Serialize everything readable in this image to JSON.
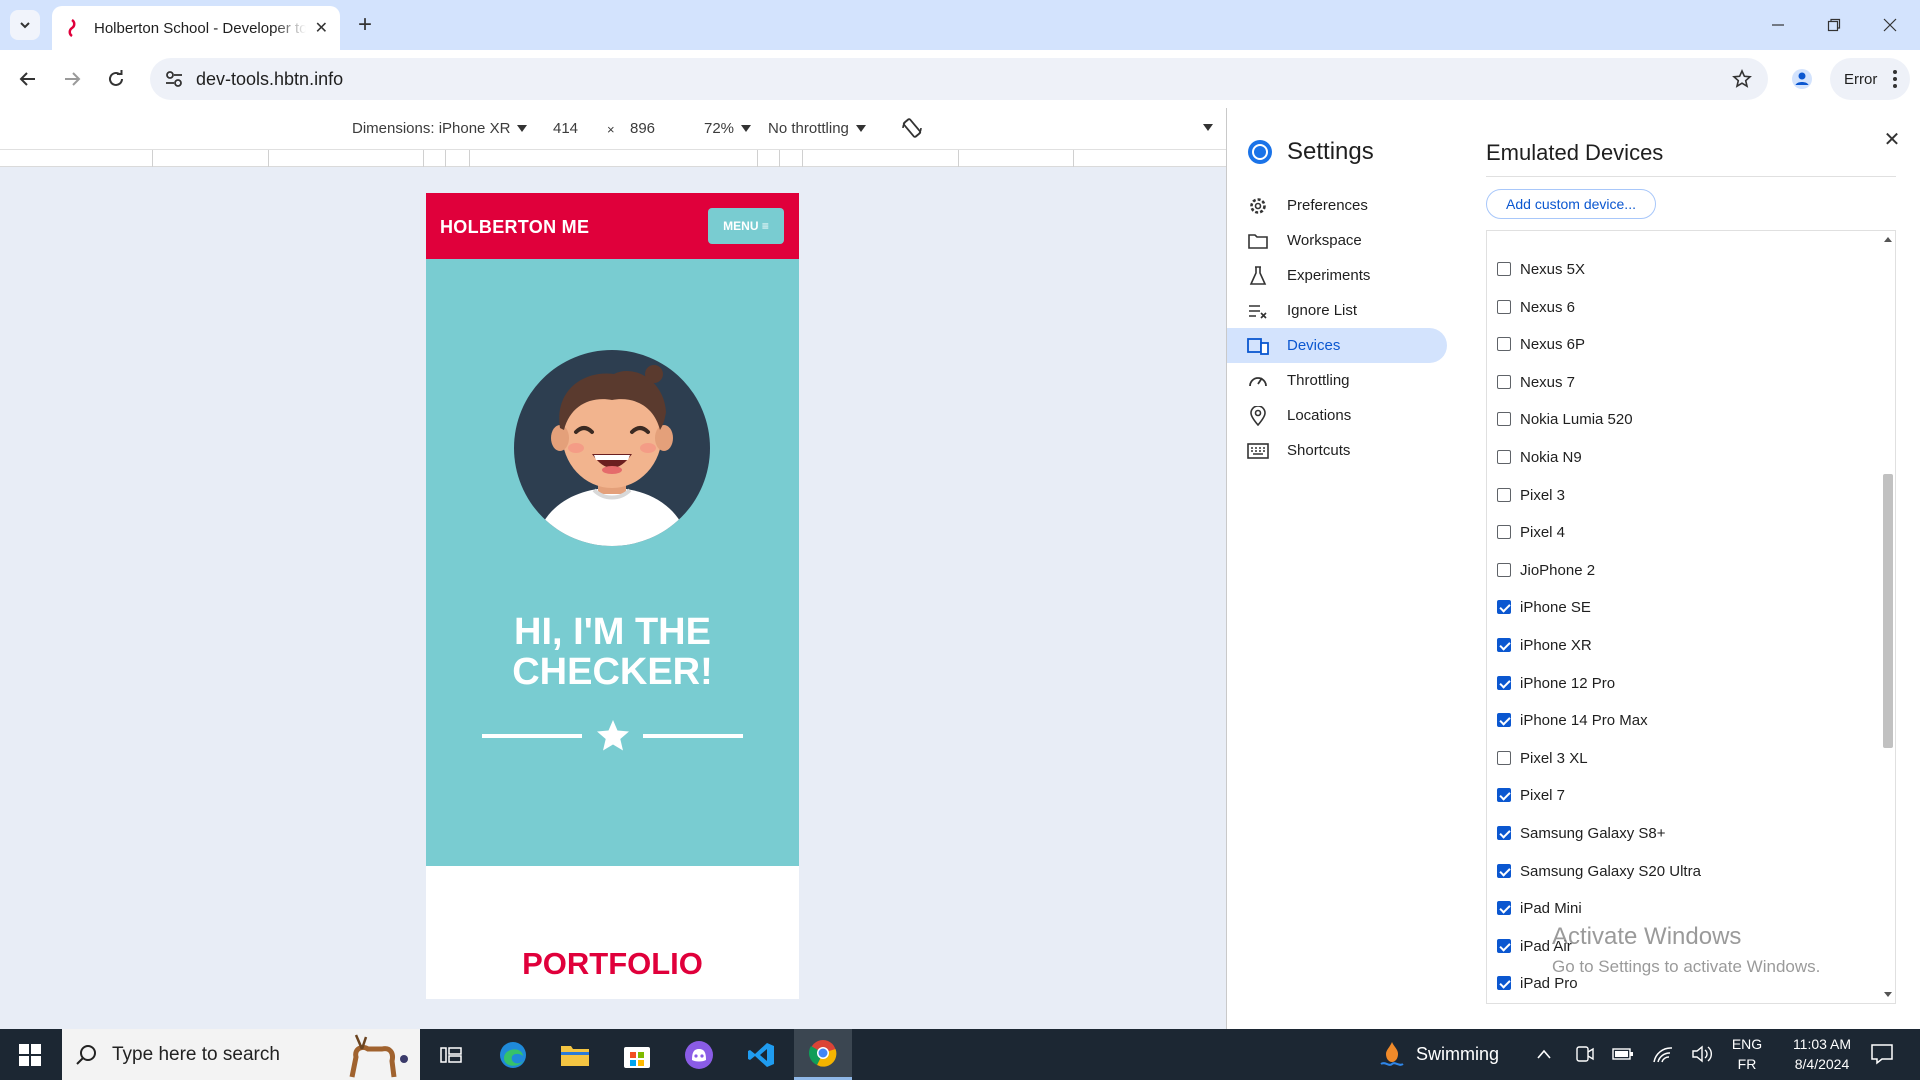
{
  "browser": {
    "tab_title": "Holberton School - Developer tools",
    "url": "dev-tools.hbtn.info",
    "profile_label": "Error"
  },
  "device_toolbar": {
    "dimensions_label": "Dimensions: iPhone XR",
    "width": "414",
    "times": "×",
    "height": "896",
    "zoom": "72%",
    "throttling": "No throttling"
  },
  "site": {
    "brand": "HOLBERTON ME",
    "menu_label": "MENU ≡",
    "hero_line1": "HI, I'M THE",
    "hero_line2": "CHECKER!",
    "section_title": "PORTFOLIO"
  },
  "settings": {
    "title": "Settings",
    "nav": [
      {
        "label": "Preferences",
        "icon": "gear-icon"
      },
      {
        "label": "Workspace",
        "icon": "folder-icon"
      },
      {
        "label": "Experiments",
        "icon": "flask-icon"
      },
      {
        "label": "Ignore List",
        "icon": "ignore-list-icon"
      },
      {
        "label": "Devices",
        "icon": "devices-icon",
        "active": true
      },
      {
        "label": "Throttling",
        "icon": "speedometer-icon"
      },
      {
        "label": "Locations",
        "icon": "location-pin-icon"
      },
      {
        "label": "Shortcuts",
        "icon": "keyboard-icon"
      }
    ],
    "panel_title": "Emulated Devices",
    "add_button": "Add custom device...",
    "devices": [
      {
        "name": "Nexus 5X",
        "checked": false
      },
      {
        "name": "Nexus 6",
        "checked": false
      },
      {
        "name": "Nexus 6P",
        "checked": false
      },
      {
        "name": "Nexus 7",
        "checked": false
      },
      {
        "name": "Nokia Lumia 520",
        "checked": false
      },
      {
        "name": "Nokia N9",
        "checked": false
      },
      {
        "name": "Pixel 3",
        "checked": false
      },
      {
        "name": "Pixel 4",
        "checked": false
      },
      {
        "name": "JioPhone 2",
        "checked": false
      },
      {
        "name": "iPhone SE",
        "checked": true
      },
      {
        "name": "iPhone XR",
        "checked": true
      },
      {
        "name": "iPhone 12 Pro",
        "checked": true
      },
      {
        "name": "iPhone 14 Pro Max",
        "checked": true
      },
      {
        "name": "Pixel 3 XL",
        "checked": false
      },
      {
        "name": "Pixel 7",
        "checked": true
      },
      {
        "name": "Samsung Galaxy S8+",
        "checked": true
      },
      {
        "name": "Samsung Galaxy S20 Ultra",
        "checked": true
      },
      {
        "name": "iPad Mini",
        "checked": true
      },
      {
        "name": "iPad Air",
        "checked": true
      },
      {
        "name": "iPad Pro",
        "checked": true
      }
    ]
  },
  "watermark": {
    "line1": "Activate Windows",
    "line2": "Go to Settings to activate Windows."
  },
  "taskbar": {
    "search_placeholder": "Type here to search",
    "weather": "Swimming",
    "lang_top": "ENG",
    "lang_bottom": "FR",
    "time": "11:03 AM",
    "date": "8/4/2024"
  },
  "colors": {
    "brand_red": "#e0003b",
    "hero_teal": "#79ccd1",
    "accent_blue": "#0b57d0"
  }
}
